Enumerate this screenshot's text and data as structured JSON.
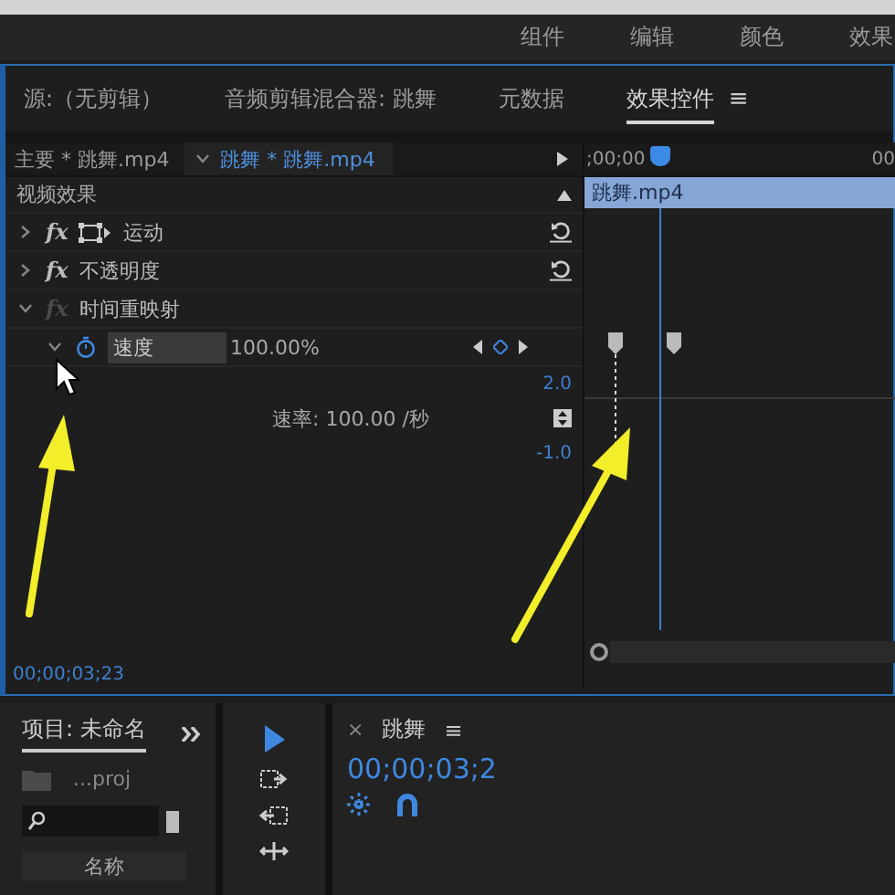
{
  "workspace_tabs": [
    "组件",
    "编辑",
    "颜色",
    "效果"
  ],
  "panel_tabs": [
    {
      "label": "源:（无剪辑）",
      "selected": false
    },
    {
      "label": "音频剪辑混合器: 跳舞",
      "selected": false
    },
    {
      "label": "元数据",
      "selected": false
    },
    {
      "label": "效果控件",
      "selected": true
    }
  ],
  "panel_menu": "≡",
  "clip_selector": {
    "master": "主要 * 跳舞.mp4",
    "sequence": "跳舞 * 跳舞.mp4"
  },
  "timeline_ruler": {
    "start": ";00;00",
    "end": "00"
  },
  "clip": {
    "name": "跳舞.mp4"
  },
  "section": "视频效果",
  "effects": [
    {
      "fx": "fx",
      "name": "运动",
      "kind": "motion",
      "expanded": false,
      "enabled": true
    },
    {
      "fx": "fx",
      "name": "不透明度",
      "kind": "plain",
      "expanded": false,
      "enabled": true
    },
    {
      "fx": "fx",
      "name": "时间重映射",
      "kind": "plain",
      "expanded": true,
      "enabled": false
    }
  ],
  "speed": {
    "name": "速度",
    "value": "100.00%",
    "expanded": true,
    "graph_max": "2.0",
    "rate": "速率: 100.00 /秒",
    "graph_min": "-1.0"
  },
  "timecode": "00;00;03;23",
  "project_panel": {
    "title": "项目: 未命名",
    "file": "...proj",
    "column": "名称"
  },
  "sequence_panel": {
    "close": "×",
    "title": "跳舞",
    "menu": "≡",
    "timecode": "00;00;03;2"
  }
}
